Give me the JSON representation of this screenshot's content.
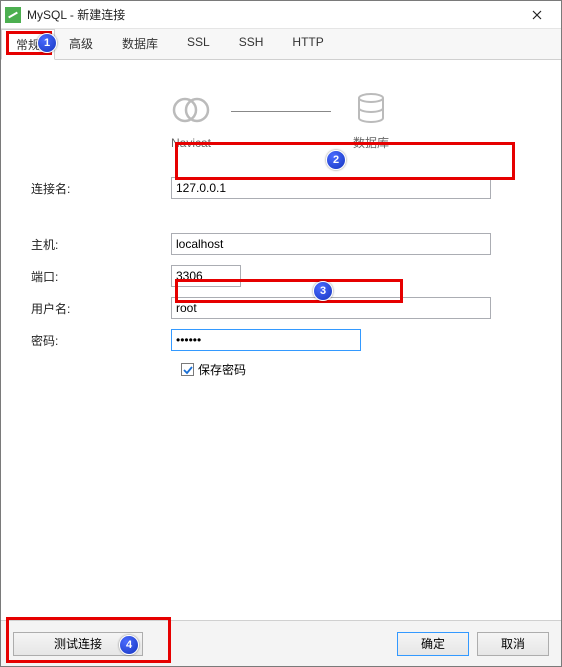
{
  "window": {
    "app_name": "MySQL",
    "title": "新建连接"
  },
  "tabs": {
    "items": [
      {
        "label": "常规"
      },
      {
        "label": "高级"
      },
      {
        "label": "数据库"
      },
      {
        "label": "SSL"
      },
      {
        "label": "SSH"
      },
      {
        "label": "HTTP"
      }
    ],
    "active_index": 0
  },
  "diagram": {
    "left_label": "Navicat",
    "right_label": "数据库"
  },
  "form": {
    "conn_name": {
      "label": "连接名:",
      "value": "127.0.0.1"
    },
    "host": {
      "label": "主机:",
      "value": "localhost"
    },
    "port": {
      "label": "端口:",
      "value": "3306"
    },
    "user": {
      "label": "用户名:",
      "value": "root"
    },
    "password": {
      "label": "密码:",
      "value": "••••••"
    },
    "save_password": {
      "label": "保存密码",
      "checked": true
    }
  },
  "buttons": {
    "test": "测试连接",
    "ok": "确定",
    "cancel": "取消"
  },
  "annotations": {
    "b1": "1",
    "b2": "2",
    "b3": "3",
    "b4": "4"
  }
}
